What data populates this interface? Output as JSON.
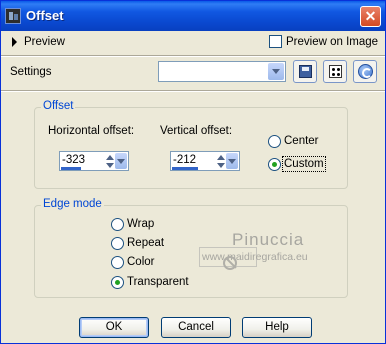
{
  "window": {
    "title": "Offset",
    "close_label": "✕"
  },
  "preview": {
    "label": "Preview",
    "preview_on_image_label": "Preview on Image",
    "preview_on_image_checked": false
  },
  "settings": {
    "label": "Settings",
    "value": ""
  },
  "offset": {
    "group_title": "Offset",
    "horizontal_label": "Horizontal offset:",
    "horizontal_value": "-323",
    "vertical_label": "Vertical offset:",
    "vertical_value": "-212",
    "center_label": "Center",
    "custom_label": "Custom",
    "selected": "Custom"
  },
  "edge_mode": {
    "group_title": "Edge mode",
    "options": [
      "Wrap",
      "Repeat",
      "Color",
      "Transparent"
    ],
    "selected": "Transparent"
  },
  "watermark": {
    "name": "Pinuccia",
    "url": "www.maidiregrafica.eu"
  },
  "buttons": {
    "ok": "OK",
    "cancel": "Cancel",
    "help": "Help"
  },
  "icons": [
    "app-icon",
    "close-icon",
    "expand-triangle-icon",
    "save-icon",
    "randomize-dice-icon",
    "reset-icon"
  ],
  "colors": {
    "titlebar": "#0a49d0",
    "dialog_bg": "#ece9d8",
    "group_title": "#0046d5",
    "radio_selected": "#21a121"
  }
}
